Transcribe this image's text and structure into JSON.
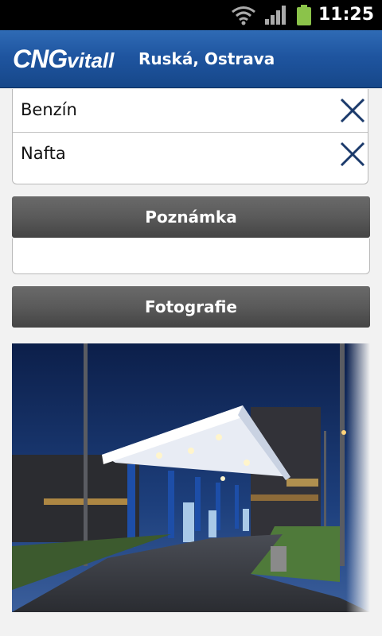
{
  "status_bar": {
    "time": "11:25",
    "icons": [
      "wifi-icon",
      "signal-icon",
      "battery-icon"
    ]
  },
  "app_bar": {
    "logo": {
      "part1": "CNG",
      "part2": "vitall"
    },
    "station": "Ruská, Ostrava"
  },
  "fuels": [
    {
      "label": "Benzín",
      "icon": "close-icon"
    },
    {
      "label": "Nafta",
      "icon": "close-icon"
    }
  ],
  "sections": {
    "note_header": "Poznámka",
    "note_value": "",
    "photos_header": "Fotografie"
  },
  "colors": {
    "appbar": "#1f55a0",
    "header": "#555555",
    "x_icon": "#1b3a6b"
  }
}
